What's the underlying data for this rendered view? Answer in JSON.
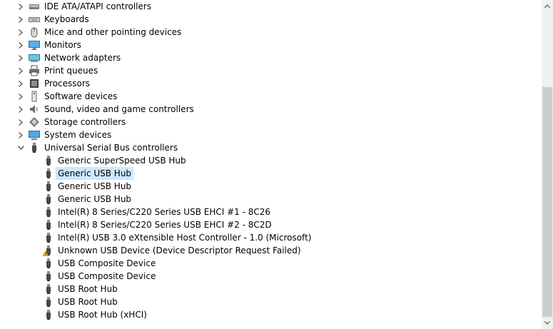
{
  "categories": [
    {
      "label": "IDE ATA/ATAPI controllers",
      "icon": "ide-controller-icon",
      "expanded": false
    },
    {
      "label": "Keyboards",
      "icon": "keyboard-icon",
      "expanded": false
    },
    {
      "label": "Mice and other pointing devices",
      "icon": "mouse-icon",
      "expanded": false
    },
    {
      "label": "Monitors",
      "icon": "monitor-icon",
      "expanded": false
    },
    {
      "label": "Network adapters",
      "icon": "network-adapter-icon",
      "expanded": false
    },
    {
      "label": "Print queues",
      "icon": "printer-icon",
      "expanded": false
    },
    {
      "label": "Processors",
      "icon": "processor-icon",
      "expanded": false
    },
    {
      "label": "Software devices",
      "icon": "software-device-icon",
      "expanded": false
    },
    {
      "label": "Sound, video and game controllers",
      "icon": "speaker-icon",
      "expanded": false
    },
    {
      "label": "Storage controllers",
      "icon": "storage-controller-icon",
      "expanded": false
    },
    {
      "label": "System devices",
      "icon": "system-device-icon",
      "expanded": false
    },
    {
      "label": "Universal Serial Bus controllers",
      "icon": "usb-icon",
      "expanded": true
    }
  ],
  "usb_devices": [
    {
      "label": "Generic SuperSpeed USB Hub",
      "icon": "usb-icon",
      "selected": false,
      "warning": false
    },
    {
      "label": "Generic USB Hub",
      "icon": "usb-icon",
      "selected": true,
      "warning": false
    },
    {
      "label": "Generic USB Hub",
      "icon": "usb-icon",
      "selected": false,
      "warning": false
    },
    {
      "label": "Generic USB Hub",
      "icon": "usb-icon",
      "selected": false,
      "warning": false
    },
    {
      "label": "Intel(R) 8 Series/C220 Series USB EHCI #1 - 8C26",
      "icon": "usb-icon",
      "selected": false,
      "warning": false
    },
    {
      "label": "Intel(R) 8 Series/C220 Series USB EHCI #2 - 8C2D",
      "icon": "usb-icon",
      "selected": false,
      "warning": false
    },
    {
      "label": "Intel(R) USB 3.0 eXtensible Host Controller - 1.0 (Microsoft)",
      "icon": "usb-icon",
      "selected": false,
      "warning": false
    },
    {
      "label": "Unknown USB Device (Device Descriptor Request Failed)",
      "icon": "usb-warning-icon",
      "selected": false,
      "warning": true
    },
    {
      "label": "USB Composite Device",
      "icon": "usb-icon",
      "selected": false,
      "warning": false
    },
    {
      "label": "USB Composite Device",
      "icon": "usb-icon",
      "selected": false,
      "warning": false
    },
    {
      "label": "USB Root Hub",
      "icon": "usb-icon",
      "selected": false,
      "warning": false
    },
    {
      "label": "USB Root Hub",
      "icon": "usb-icon",
      "selected": false,
      "warning": false
    },
    {
      "label": "USB Root Hub (xHCI)",
      "icon": "usb-icon",
      "selected": false,
      "warning": false
    }
  ],
  "colors": {
    "selection": "#cce8ff",
    "scrollbar_track": "#f0f0f0",
    "scrollbar_thumb": "#cdcdcd",
    "warning": "#f2c811"
  }
}
